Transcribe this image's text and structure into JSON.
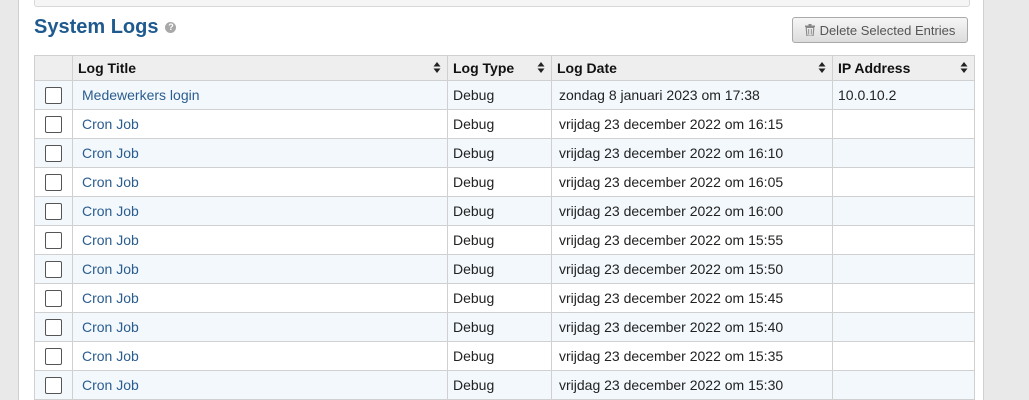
{
  "page": {
    "title": "System Logs",
    "help_icon": "?",
    "delete_button_label": "Delete Selected Entries"
  },
  "table": {
    "headers": [
      "Log Title",
      "Log Type",
      "Log Date",
      "IP Address"
    ],
    "rows": [
      {
        "title": "Medewerkers login",
        "type": "Debug",
        "date": "zondag 8 januari 2023 om 17:38",
        "ip": "10.0.10.2"
      },
      {
        "title": "Cron Job",
        "type": "Debug",
        "date": "vrijdag 23 december 2022 om 16:15",
        "ip": ""
      },
      {
        "title": "Cron Job",
        "type": "Debug",
        "date": "vrijdag 23 december 2022 om 16:10",
        "ip": ""
      },
      {
        "title": "Cron Job",
        "type": "Debug",
        "date": "vrijdag 23 december 2022 om 16:05",
        "ip": ""
      },
      {
        "title": "Cron Job",
        "type": "Debug",
        "date": "vrijdag 23 december 2022 om 16:00",
        "ip": ""
      },
      {
        "title": "Cron Job",
        "type": "Debug",
        "date": "vrijdag 23 december 2022 om 15:55",
        "ip": ""
      },
      {
        "title": "Cron Job",
        "type": "Debug",
        "date": "vrijdag 23 december 2022 om 15:50",
        "ip": ""
      },
      {
        "title": "Cron Job",
        "type": "Debug",
        "date": "vrijdag 23 december 2022 om 15:45",
        "ip": ""
      },
      {
        "title": "Cron Job",
        "type": "Debug",
        "date": "vrijdag 23 december 2022 om 15:40",
        "ip": ""
      },
      {
        "title": "Cron Job",
        "type": "Debug",
        "date": "vrijdag 23 december 2022 om 15:35",
        "ip": ""
      },
      {
        "title": "Cron Job",
        "type": "Debug",
        "date": "vrijdag 23 december 2022 om 15:30",
        "ip": ""
      }
    ]
  },
  "colors": {
    "title": "#1e5a8e",
    "link": "#2a5d8f",
    "row_alt": "#f3f8fc"
  }
}
